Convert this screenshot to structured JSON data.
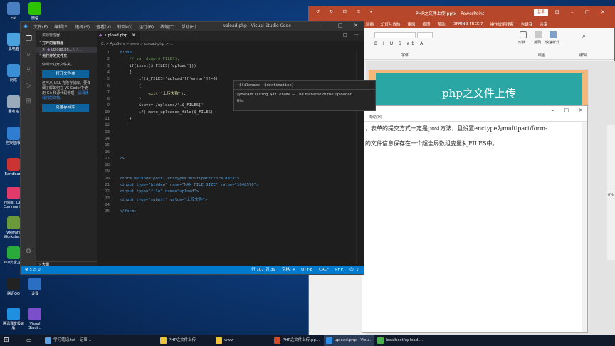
{
  "desktop_icons": [
    {
      "label": "cai",
      "color": "#4a7fc1"
    },
    {
      "label": "微信",
      "color": "#2dc100"
    },
    {
      "label": "此电脑",
      "color": "#4aa3df"
    },
    {
      "label": "网络",
      "color": "#3a8fd6"
    },
    {
      "label": "回收站",
      "color": "#9ab"
    },
    {
      "label": "控制面板",
      "color": "#2e7dd1"
    },
    {
      "label": "Bandicam",
      "color": "#c33"
    },
    {
      "label": "IntelliJ IDEA Communi...",
      "color": "#e23a6a"
    },
    {
      "label": "VMware Workstat...",
      "color": "#6b9a3a"
    },
    {
      "label": "360安全卫士",
      "color": "#2aaa3a"
    },
    {
      "label": "腾讯QQ",
      "color": "#222"
    },
    {
      "label": "设置",
      "color": "#2a6fc1"
    },
    {
      "label": "腾讯课堂极速版",
      "color": "#1f8fe0"
    },
    {
      "label": "Visual Studi...",
      "color": "#7b4fc9"
    }
  ],
  "ppt": {
    "quick_access": "↺ ↻ ⊡ ⊡ ▾",
    "title": "PHP之文件上传.pptx - PowerPoint",
    "login": "登录",
    "menu": [
      "动画",
      "幻灯片放映",
      "审阅",
      "视图",
      "帮助",
      "iSPRING FREE 7",
      "操作说明搜索",
      "告诉我",
      "共享"
    ],
    "groups": [
      "字体",
      "绘图",
      "编辑"
    ],
    "ribbon_tools": [
      "形状",
      "排列",
      "快速样式"
    ],
    "slide_title": "php之文件上传",
    "zoom": "6%"
  },
  "browser": {
    "menu": "帮助(H)",
    "lines": [
      "，表单的提交方式一定是post方法，且设置enctype为multipart/form-",
      "的文件信息保存在一个超全局数组变量$_FILES中。"
    ]
  },
  "vscode": {
    "menu": [
      "文件(F)",
      "编辑(E)",
      "选择(S)",
      "查看(V)",
      "转到(G)",
      "运行(R)",
      "终端(T)",
      "帮助(H)"
    ],
    "window_title": "upload.php - Visual Studio Code",
    "explorer_header": "资源管理器",
    "open_editors": "打开的编辑器",
    "open_file": "upload.ph...",
    "open_file_path": "C:\\...",
    "no_folder": "无打开的文件夹",
    "no_folder_msg": "你尚未打开文件夹。",
    "open_folder_btn": "打开文件夹",
    "clone_msg": "还可从 URL 克隆存储库。要详细了解如何在 VS Code 中使用 Git 和源代码管理，",
    "clone_link": "请阅读我们的文档。",
    "clone_btn": "克隆存储库",
    "outline": "大纲",
    "tab_label": "upload.php",
    "breadcrumb": "C: > AppServ > www > upload.php > ...",
    "code_lines": [
      {
        "n": "1",
        "t": "<?php"
      },
      {
        "n": "2",
        "t": "    // var_dump($_FILES);"
      },
      {
        "n": "3",
        "t": "    if(isset($_FILES['upload']))"
      },
      {
        "n": "4",
        "t": "    {"
      },
      {
        "n": "5",
        "t": "        if($_FILES['upload']['error']!=0)"
      },
      {
        "n": "6",
        "t": "        {"
      },
      {
        "n": "7",
        "t": "            exit('上传失败');"
      },
      {
        "n": "8",
        "t": "        }"
      },
      {
        "n": "9",
        "t": "        $save='/uploads/'.$_FILES['"
      },
      {
        "n": "10",
        "t": "        if(!move_uploaded_file($_FILES)"
      },
      {
        "n": "11",
        "t": "    }"
      },
      {
        "n": "12",
        "t": ""
      },
      {
        "n": "13",
        "t": ""
      },
      {
        "n": "14",
        "t": ""
      },
      {
        "n": "15",
        "t": ""
      },
      {
        "n": "16",
        "t": ""
      },
      {
        "n": "17",
        "t": "?>"
      },
      {
        "n": "18",
        "t": ""
      },
      {
        "n": "19",
        "t": ""
      },
      {
        "n": "20",
        "t": "<form method=\"post\" enctype=\"multipart/form-data\">"
      },
      {
        "n": "21",
        "t": "<input type=\"hidden\" name=\"MAX_FILE_SIZE\" value=\"1048576\">"
      },
      {
        "n": "22",
        "t": "<input type=\"file\" name=\"upload\">"
      },
      {
        "n": "23",
        "t": "<input type=\"submit\" value=\"上传文件\">"
      },
      {
        "n": "24",
        "t": ""
      },
      {
        "n": "25",
        "t": "</form>"
      }
    ],
    "hover_sig": "($filename, $destination)",
    "hover_param": "@param",
    "hover_type": "string $filename",
    "hover_desc": " — The filename of the uploaded",
    "hover_desc2": "file.",
    "status_left": "⊗ 5 ⚠ 0",
    "status_right": [
      "行 10，列 39",
      "空格: 4",
      "UTF-8",
      "CRLF",
      "PHP"
    ]
  },
  "taskbar": [
    {
      "label": "学习笔记.txt - 记事...",
      "color": "#5ea0e0"
    },
    {
      "label": "PHP之文件上传",
      "color": "#f0c23a"
    },
    {
      "label": "www",
      "color": "#f0c23a"
    },
    {
      "label": "PHP之文件上传.pp...",
      "color": "#d04a2a"
    },
    {
      "label": "upload.php - Visu...",
      "color": "#2b8ce6"
    },
    {
      "label": "localhost/upload....",
      "color": "#4caf50"
    }
  ]
}
